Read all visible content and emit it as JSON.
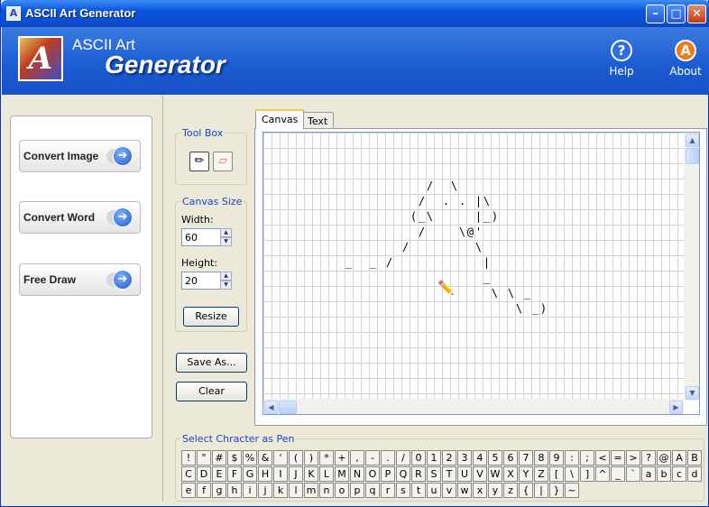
{
  "window": {
    "title": "ASCII Art Generator",
    "icon": "app-icon"
  },
  "banner": {
    "line1": "ASCII Art",
    "line2": "Generator",
    "help_label": "Help",
    "about_label": "About"
  },
  "nav": [
    "Convert Image",
    "Convert Word",
    "Free Draw"
  ],
  "toolbox": {
    "title": "Tool Box",
    "tools": [
      "pencil-icon",
      "eraser-icon"
    ],
    "selected": "pencil-icon"
  },
  "canvas_size": {
    "title": "Canvas Size",
    "width_label": "Width:",
    "width_value": "60",
    "height_label": "Height:",
    "height_value": "20",
    "resize_label": "Resize"
  },
  "actions": {
    "save_as": "Save As...",
    "clear": "Clear"
  },
  "tabs": [
    "Canvas",
    "Text"
  ],
  "active_tab": "Canvas",
  "drawing_rows": [
    "",
    "",
    "",
    "                    /  \\",
    "                   /  . . |\\",
    "                  (_\\     |_)",
    "                   /    \\@'",
    "                 /        \\",
    "          _  _ /           |",
    "                           _",
    "                            \\ \\ _",
    "                               \\ _)"
  ],
  "pen_group_title": "Select Chracter as Pen",
  "pen_rows": [
    [
      "!",
      "\"",
      "#",
      "$",
      "%",
      "&",
      "'",
      "(",
      ")",
      "*",
      "+",
      ",",
      "-",
      ".",
      "/",
      "0",
      "1",
      "2",
      "3",
      "4",
      "5",
      "6",
      "7",
      "8",
      "9",
      ":",
      ";",
      "<",
      "=",
      ">",
      "?",
      "@",
      "A",
      "B"
    ],
    [
      "C",
      "D",
      "E",
      "F",
      "G",
      "H",
      "I",
      "J",
      "K",
      "L",
      "M",
      "N",
      "O",
      "P",
      "Q",
      "R",
      "S",
      "T",
      "U",
      "V",
      "W",
      "X",
      "Y",
      "Z",
      "[",
      "\\",
      "]",
      "^",
      "_",
      "`",
      "a",
      "b",
      "c",
      "d"
    ],
    [
      "e",
      "f",
      "g",
      "h",
      "i",
      "j",
      "k",
      "l",
      "m",
      "n",
      "o",
      "p",
      "q",
      "r",
      "s",
      "t",
      "u",
      "v",
      "w",
      "x",
      "y",
      "z",
      "{",
      "|",
      "}",
      "~"
    ]
  ]
}
